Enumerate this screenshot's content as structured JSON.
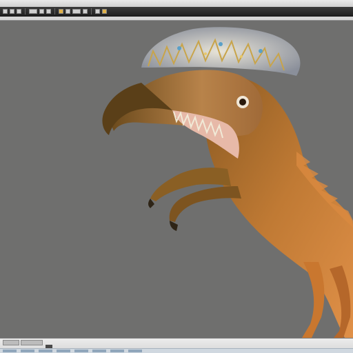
{
  "window": {
    "title_strip": "",
    "toolbar_buttons": [
      "tool-1",
      "tool-2",
      "tool-3",
      "tool-4",
      "tool-5",
      "tool-6",
      "tool-7",
      "tool-8",
      "tool-9",
      "tool-10",
      "tool-11",
      "tool-12"
    ]
  },
  "viewport": {
    "background_color": "#6f6f6e",
    "subject": "creature-render"
  },
  "status_bar": {
    "tabs": [
      "",
      "",
      ""
    ]
  },
  "taskbar": {
    "items": [
      "",
      "",
      "",
      "",
      "",
      "",
      "",
      ""
    ]
  },
  "colors": {
    "viewport_bg": "#6f6f6e",
    "toolbar_bg": "#2a2a2a",
    "accent": "#e0b24a",
    "creature_body": "#b9712e",
    "creature_dark": "#6b4a1c"
  }
}
